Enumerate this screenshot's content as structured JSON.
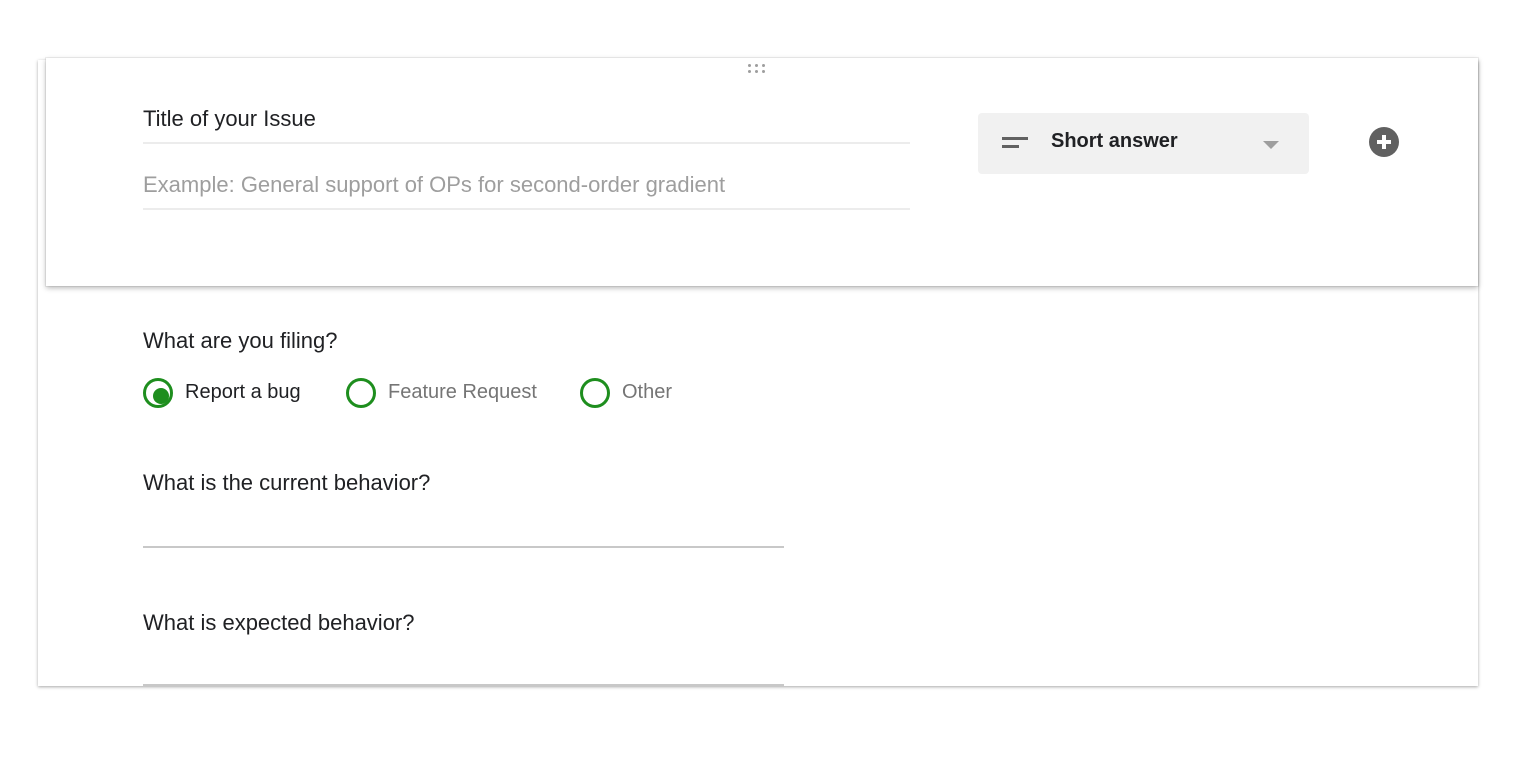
{
  "question": {
    "title": "Title of your Issue",
    "placeholder": "Example: General support of OPs for second-order gradient",
    "type_select": {
      "selected": "Short answer"
    }
  },
  "filing": {
    "label": "What are you filing?",
    "options": [
      {
        "label": "Report a bug",
        "selected": true
      },
      {
        "label": "Feature Request",
        "selected": false
      },
      {
        "label": "Other",
        "selected": false
      }
    ]
  },
  "current_behavior": {
    "label": "What is the current behavior?",
    "value": ""
  },
  "expected_behavior": {
    "label": "What is expected behavior?",
    "value": ""
  },
  "colors": {
    "accent": "#1e8e1e",
    "selected_text": "#202124",
    "unselected_text": "#757575",
    "placeholder_text": "#9e9e9e"
  },
  "icons": [
    "drag-handle-icon",
    "short-answer-icon",
    "chevron-down-icon",
    "add-circle-icon"
  ]
}
